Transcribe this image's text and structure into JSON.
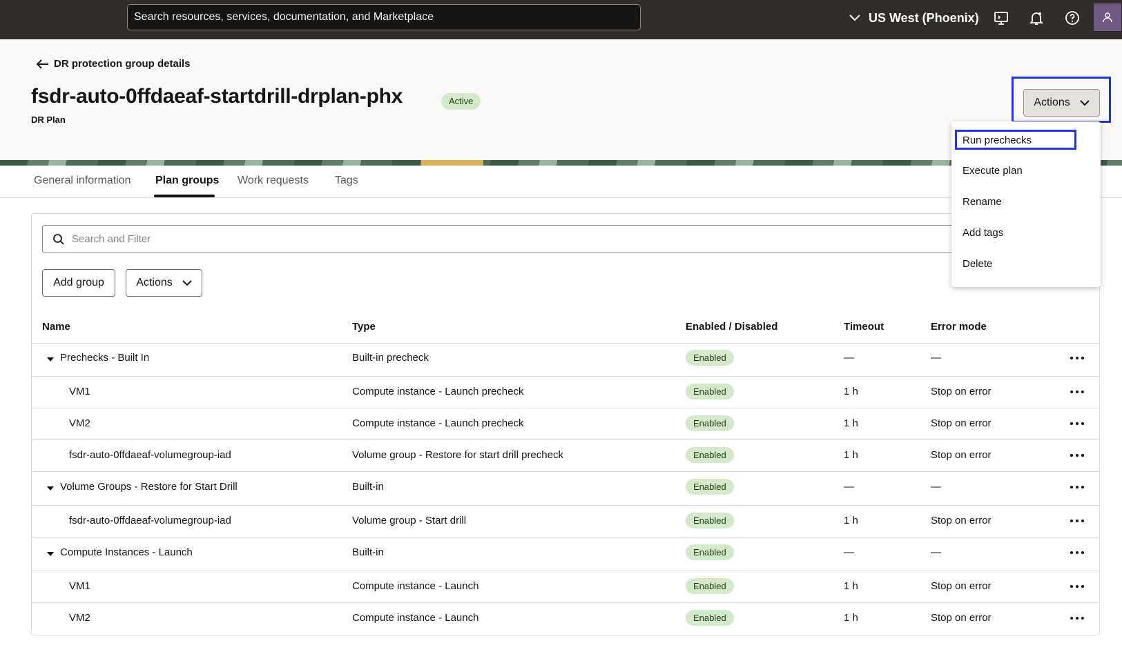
{
  "topbar": {
    "search_placeholder": "Search resources, services, documentation, and Marketplace",
    "region": "US West (Phoenix)",
    "icons": [
      "chevron-down-icon",
      "cloud-shell-icon",
      "bell-icon",
      "help-icon",
      "user-icon"
    ]
  },
  "header": {
    "back_label": "DR protection group details",
    "title": "fsdr-auto-0ffdaeaf-startdrill-drplan-phx",
    "status": "Active",
    "subtitle": "DR Plan",
    "actions_label": "Actions"
  },
  "tabs": [
    {
      "label": "General information"
    },
    {
      "label": "Plan groups",
      "active": true
    },
    {
      "label": "Work requests"
    },
    {
      "label": "Tags"
    }
  ],
  "filter": {
    "placeholder": "Search and Filter"
  },
  "toolbar": {
    "add_group": "Add group",
    "actions": "Actions"
  },
  "table": {
    "columns": [
      "Name",
      "Type",
      "Enabled / Disabled",
      "Timeout",
      "Error mode"
    ],
    "rows": [
      {
        "name": "Prechecks - Built In",
        "type": "Built-in precheck",
        "enabled": "Enabled",
        "timeout": "—",
        "error_mode": "—",
        "group": true
      },
      {
        "name": "VM1",
        "type": "Compute instance - Launch precheck",
        "enabled": "Enabled",
        "timeout": "1 h",
        "error_mode": "Stop on error",
        "group": false
      },
      {
        "name": "VM2",
        "type": "Compute instance - Launch precheck",
        "enabled": "Enabled",
        "timeout": "1 h",
        "error_mode": "Stop on error",
        "group": false
      },
      {
        "name": "fsdr-auto-0ffdaeaf-volumegroup-iad",
        "type": "Volume group - Restore for start drill precheck",
        "enabled": "Enabled",
        "timeout": "1 h",
        "error_mode": "Stop on error",
        "group": false
      },
      {
        "name": "Volume Groups - Restore for Start Drill",
        "type": "Built-in",
        "enabled": "Enabled",
        "timeout": "—",
        "error_mode": "—",
        "group": true
      },
      {
        "name": "fsdr-auto-0ffdaeaf-volumegroup-iad",
        "type": "Volume group - Start drill",
        "enabled": "Enabled",
        "timeout": "1 h",
        "error_mode": "Stop on error",
        "group": false
      },
      {
        "name": "Compute Instances - Launch",
        "type": "Built-in",
        "enabled": "Enabled",
        "timeout": "—",
        "error_mode": "—",
        "group": true
      },
      {
        "name": "VM1",
        "type": "Compute instance - Launch",
        "enabled": "Enabled",
        "timeout": "1 h",
        "error_mode": "Stop on error",
        "group": false
      },
      {
        "name": "VM2",
        "type": "Compute instance - Launch",
        "enabled": "Enabled",
        "timeout": "1 h",
        "error_mode": "Stop on error",
        "group": false
      }
    ]
  },
  "actions_menu": {
    "items": [
      "Run prechecks",
      "Execute plan",
      "Rename",
      "Add tags",
      "Delete"
    ],
    "highlighted": "Run prechecks"
  },
  "colors": {
    "topbar_bg": "#312d2a",
    "header_bg": "#fbf9f8",
    "badge_bg": "#d4e8ca",
    "highlight_border": "#1c36e6"
  }
}
